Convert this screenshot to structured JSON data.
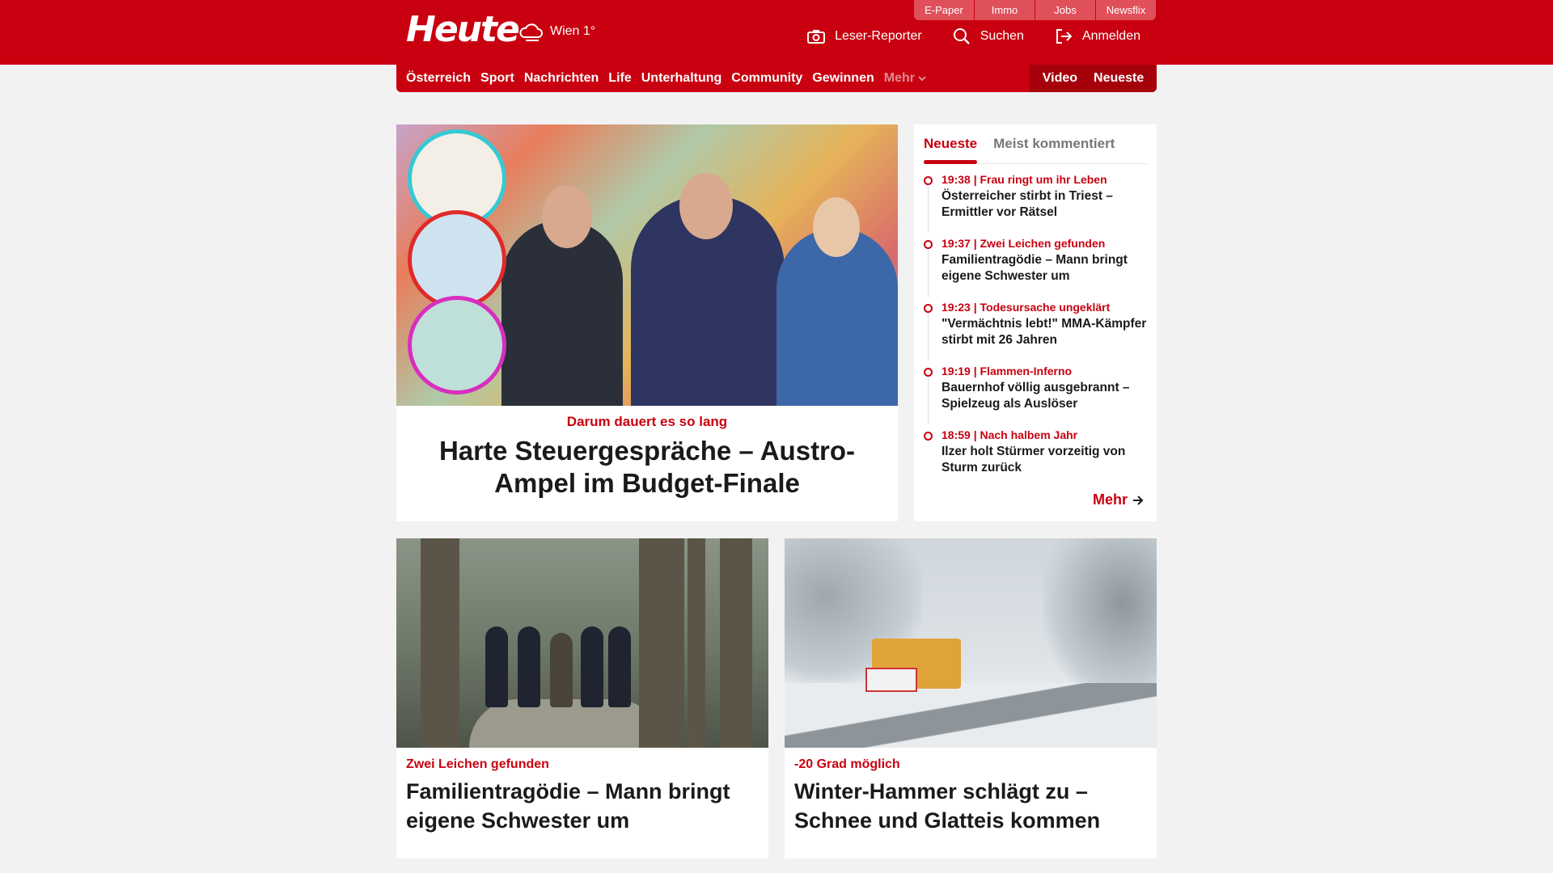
{
  "header": {
    "logo": "Heute",
    "weather": {
      "location_temp": "Wien 1°"
    },
    "quicklinks": [
      "E-Paper",
      "Immo",
      "Jobs",
      "Newsflix"
    ],
    "actions": {
      "reporter": "Leser-Reporter",
      "search": "Suchen",
      "login": "Anmelden"
    }
  },
  "nav": {
    "items": [
      "Österreich",
      "Sport",
      "Nachrichten",
      "Life",
      "Unterhaltung",
      "Community",
      "Gewinnen"
    ],
    "more": "Mehr",
    "right": [
      "Video",
      "Neueste"
    ]
  },
  "hero": {
    "kicker": "Darum dauert es so lang",
    "title": "Harte Steuergespräche – Austro-Ampel im Budget-Finale"
  },
  "sidebar": {
    "tabs": [
      "Neueste",
      "Meist kommentiert"
    ],
    "items": [
      {
        "meta": "19:38 | Frau ringt um ihr Leben",
        "headline": "Österreicher stirbt in Triest – Ermittler vor Rätsel"
      },
      {
        "meta": "19:37 | Zwei Leichen gefunden",
        "headline": "Familientragödie – Mann bringt eigene Schwester um"
      },
      {
        "meta": "19:23 | Todesursache ungeklärt",
        "headline": "\"Vermächtnis lebt!\" MMA-Kämpfer stirbt mit 26 Jahren"
      },
      {
        "meta": "19:19 | Flammen-Inferno",
        "headline": "Bauernhof völlig ausgebrannt – Spielzeug als Auslöser"
      },
      {
        "meta": "18:59 | Nach halbem Jahr",
        "headline": "Ilzer holt Stürmer vorzeitig von Sturm zurück"
      }
    ],
    "more": "Mehr"
  },
  "cards": [
    {
      "kicker": "Zwei Leichen gefunden",
      "title": "Familientragödie – Mann bringt eigene Schwester um"
    },
    {
      "kicker": "-20 Grad möglich",
      "title": "Winter-Hammer schlägt zu – Schnee und Glatteis kommen"
    }
  ],
  "colors": {
    "brand": "#c8000f",
    "background": "#f2f2f2"
  }
}
